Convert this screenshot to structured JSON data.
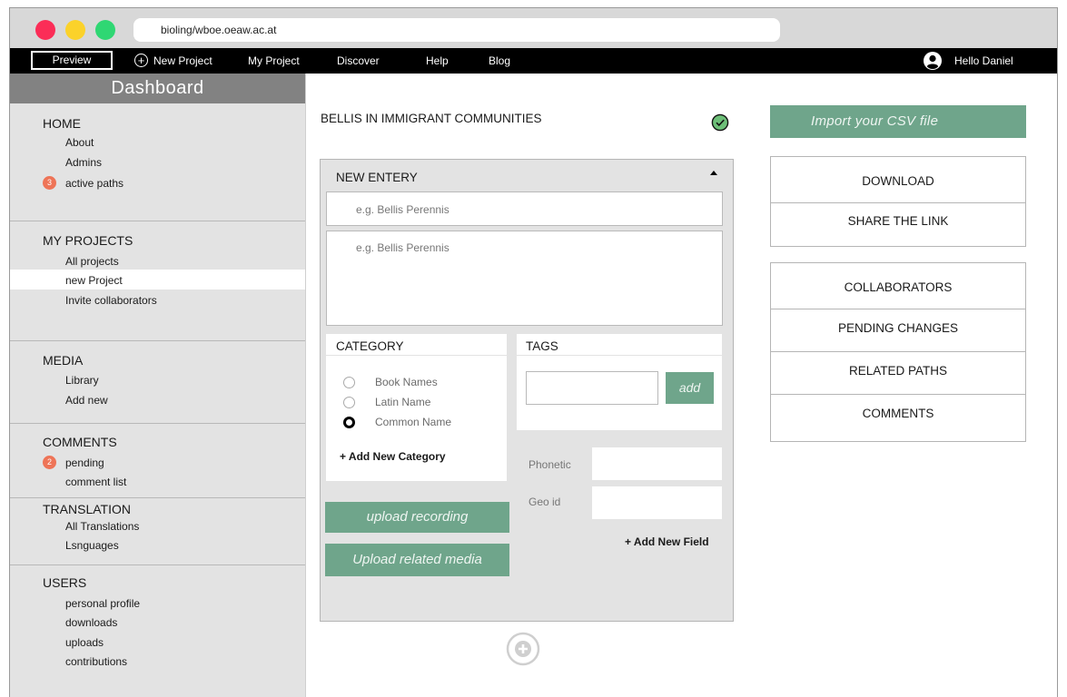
{
  "browser": {
    "url": "bioling/wboe.oeaw.ac.at"
  },
  "nav": {
    "preview": "Preview",
    "new_project": "New Project",
    "my_project": "My Project",
    "discover": "Discover",
    "help": "Help",
    "blog": "Blog",
    "user_greeting": "Hello Daniel"
  },
  "sidebar": {
    "title": "Dashboard",
    "home": {
      "title": "HOME",
      "about": "About",
      "admins": "Admins",
      "active_count": "3",
      "active_paths": "active paths"
    },
    "projects": {
      "title": "MY PROJECTS",
      "all": "All projects",
      "new": "new Project",
      "invite": "Invite collaborators"
    },
    "media": {
      "title": "MEDIA",
      "library": "Library",
      "add_new": "Add new"
    },
    "comments": {
      "title": "COMMENTS",
      "pending_count": "2",
      "pending": "pending",
      "list": "comment list"
    },
    "translation": {
      "title": "TRANSLATION",
      "all": "All Translations",
      "languages": "Lsnguages"
    },
    "users": {
      "title": "USERS",
      "profile": "personal profile",
      "downloads": "downloads",
      "uploads": "uploads",
      "contributions": "contributions"
    }
  },
  "main": {
    "project_title": "BELLIS IN IMMIGRANT COMMUNITIES",
    "entry": {
      "title": "NEW ENTERY",
      "name_placeholder": "e.g. Bellis Perennis",
      "desc_placeholder": "e.g. Bellis Perennis"
    },
    "category": {
      "title": "CATEGORY",
      "options": [
        "Book Names",
        "Latin Name",
        "Common Name"
      ],
      "selected": "Common Name",
      "add_label": "+ Add New Category"
    },
    "tags": {
      "title": "TAGS",
      "add_button": "add"
    },
    "fields": {
      "phonetic": "Phonetic",
      "geo_id": "Geo id",
      "add_field": "+ Add New Field"
    },
    "upload_recording": "upload recording",
    "upload_media": "Upload  related media"
  },
  "right": {
    "import_csv": "Import  your CSV file",
    "download": "DOWNLOAD",
    "share_link": "SHARE THE LINK",
    "collaborators": "COLLABORATORS",
    "pending_changes": "PENDING CHANGES",
    "related_paths": "RELATED PATHS",
    "comments": "COMMENTS"
  },
  "colors": {
    "accent_green": "#6fa58b",
    "badge_orange": "#ee7457",
    "traffic_red": "#fb2d57",
    "traffic_yellow": "#fbd22a",
    "traffic_green": "#2fd773",
    "sidebar_header": "#828282"
  },
  "icons": [
    "plus-circle-icon",
    "user-avatar-icon",
    "check-circle-icon",
    "collapse-caret-icon",
    "add-entry-circle-icon"
  ]
}
